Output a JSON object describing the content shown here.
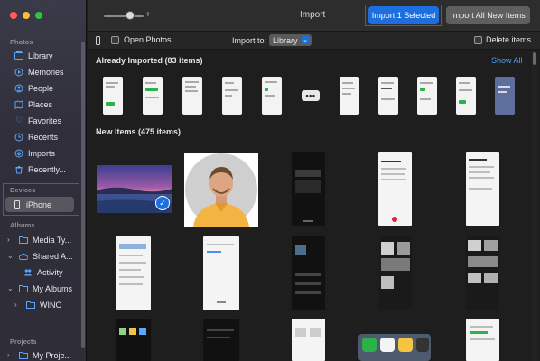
{
  "window": {
    "title": "Import"
  },
  "toolbar": {
    "zoom_minus": "−",
    "zoom_plus": "+",
    "import_selected_label": "Import 1 Selected",
    "import_all_label": "Import All New Items"
  },
  "options": {
    "open_photos_label": "Open Photos",
    "import_to_label": "Import to:",
    "import_to_value": "Library",
    "delete_items_label": "Delete items"
  },
  "sidebar": {
    "photos_header": "Photos",
    "photos_items": [
      {
        "label": "Library",
        "icon": "library-icon"
      },
      {
        "label": "Memories",
        "icon": "memories-icon"
      },
      {
        "label": "People",
        "icon": "people-icon"
      },
      {
        "label": "Places",
        "icon": "places-icon"
      },
      {
        "label": "Favorites",
        "icon": "heart-icon"
      },
      {
        "label": "Recents",
        "icon": "clock-icon"
      },
      {
        "label": "Imports",
        "icon": "imports-icon"
      },
      {
        "label": "Recently...",
        "icon": "trash-icon"
      }
    ],
    "devices_header": "Devices",
    "device": {
      "label": "iPhone",
      "icon": "iphone-icon"
    },
    "albums_header": "Albums",
    "albums_items": [
      {
        "label": "Media Ty..."
      },
      {
        "label": "Shared A..."
      },
      {
        "label": "Activity"
      },
      {
        "label": "My Albums"
      },
      {
        "label": "WINO"
      }
    ],
    "projects_header": "Projects",
    "projects_item": {
      "label": "My Proje..."
    }
  },
  "content": {
    "already_imported_title": "Already Imported (83 items)",
    "show_all_label": "Show All",
    "ellipsis_label": "•••",
    "new_items_title": "New Items (475 items)"
  },
  "colors": {
    "accent": "#1d6fe0",
    "highlight_box": "#d8262c",
    "link": "#4aa0ff"
  }
}
